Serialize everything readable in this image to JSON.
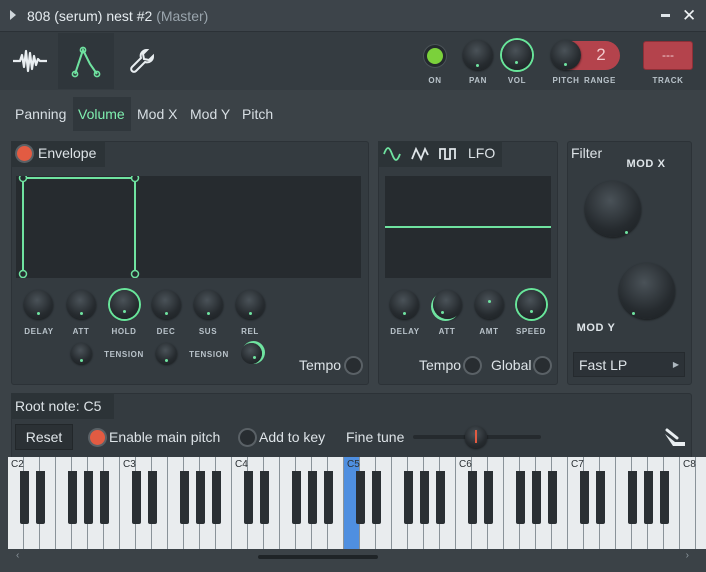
{
  "window": {
    "title_main": "808 (serum) nest #2",
    "title_suffix": "(Master)"
  },
  "toolbar": {
    "tabs": [
      "waveform-icon",
      "envelope-icon",
      "wrench-icon"
    ],
    "on_label": "ON",
    "pan_label": "PAN",
    "vol_label": "VOL",
    "pitch_label": "PITCH",
    "range_label": "RANGE",
    "range_value": "2",
    "track_value": "---",
    "track_label": "TRACK"
  },
  "subtabs": [
    "Panning",
    "Volume",
    "Mod X",
    "Mod Y",
    "Pitch"
  ],
  "active_subtab": "Volume",
  "envelope": {
    "label": "Envelope",
    "enabled": true,
    "knobs": [
      "DELAY",
      "ATT",
      "HOLD",
      "DEC",
      "SUS",
      "REL"
    ],
    "tension_label_1": "TENSION",
    "tension_label_2": "TENSION",
    "tempo_label": "Tempo"
  },
  "lfo": {
    "label": "LFO",
    "shapes": [
      "sine-icon",
      "triangle-icon",
      "square-icon"
    ],
    "knobs": [
      "DELAY",
      "ATT",
      "AMT",
      "SPEED"
    ],
    "tempo_label": "Tempo",
    "global_label": "Global"
  },
  "filter": {
    "label": "Filter",
    "modx_label": "MOD X",
    "mody_label": "MOD Y",
    "type_value": "Fast LP"
  },
  "keyboard_section": {
    "root_note_label": "Root note: C5",
    "reset_label": "Reset",
    "enable_main_pitch_label": "Enable main pitch",
    "enable_main_pitch": true,
    "add_to_key_label": "Add to key",
    "add_to_key": false,
    "fine_tune_label": "Fine tune",
    "octave_labels": [
      "C2",
      "C3",
      "C4",
      "C5",
      "C6",
      "C7",
      "C8"
    ],
    "selected_key": "C5"
  },
  "colors": {
    "accent_green": "#6fe3a0",
    "led_red": "#e25b42",
    "key_highlight": "#4f8fe0",
    "track_red": "#b4434c"
  }
}
